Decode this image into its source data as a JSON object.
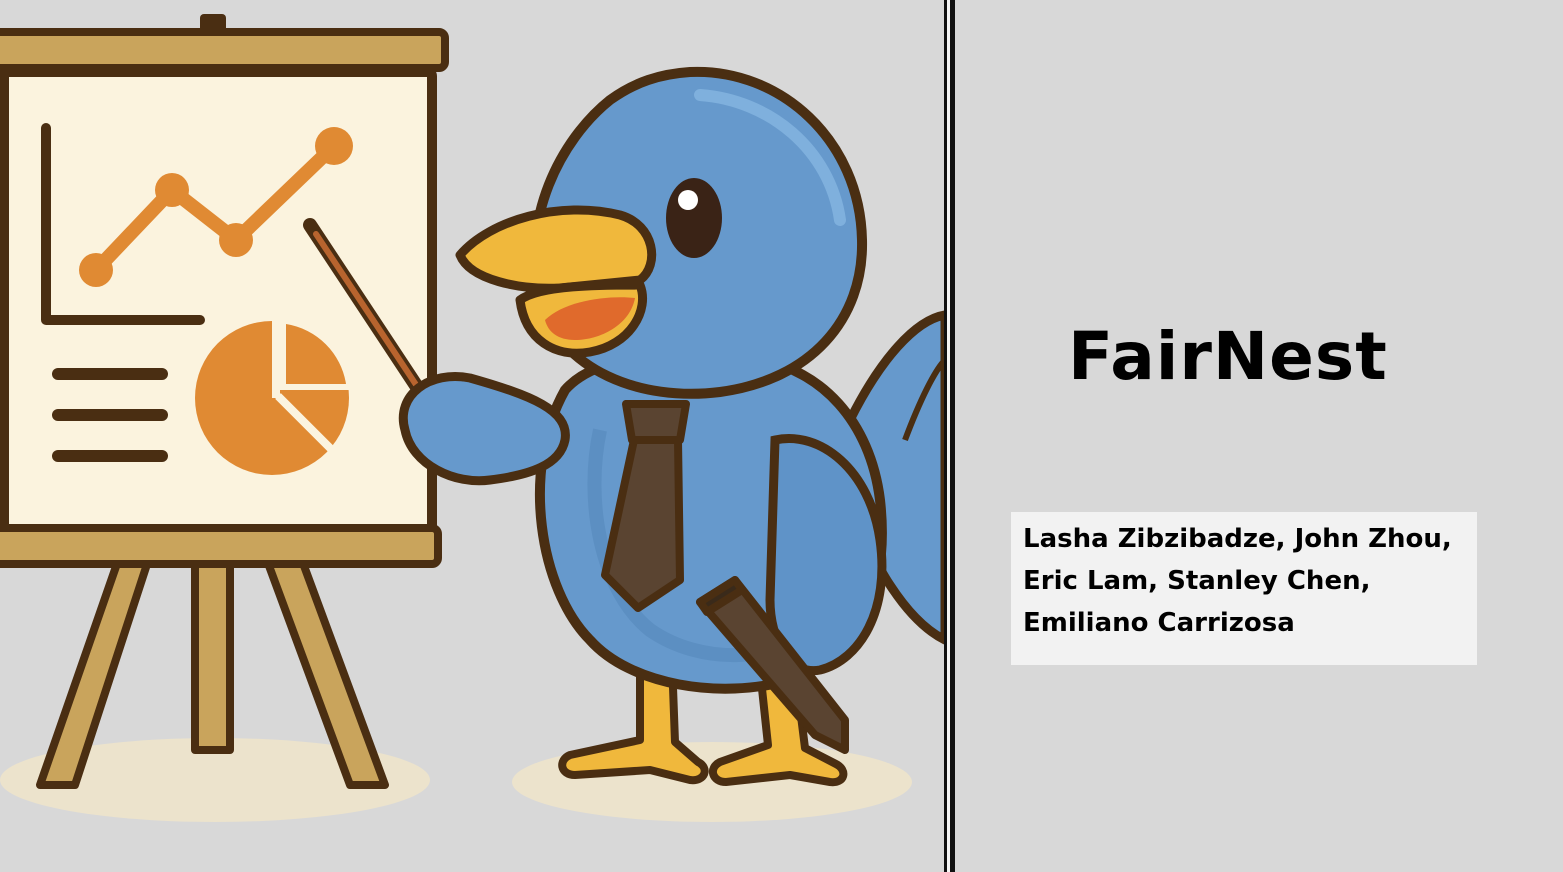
{
  "slide": {
    "title": "FairNest",
    "authors": [
      "Lasha Zibzibadze, John Zhou,",
      "Eric Lam, Stanley Chen,",
      "Emiliano Carrizosa"
    ]
  },
  "colors": {
    "background": "#d8d8d8",
    "authors_box": "#f2f2f2",
    "bird_blue": "#6699cc",
    "beak_yellow": "#f0b83c",
    "chart_orange": "#e08a33",
    "easel_wood": "#c9a45c",
    "outline": "#4a2e12"
  },
  "illustration": {
    "subject": "blue-bird-presenter-icon"
  }
}
